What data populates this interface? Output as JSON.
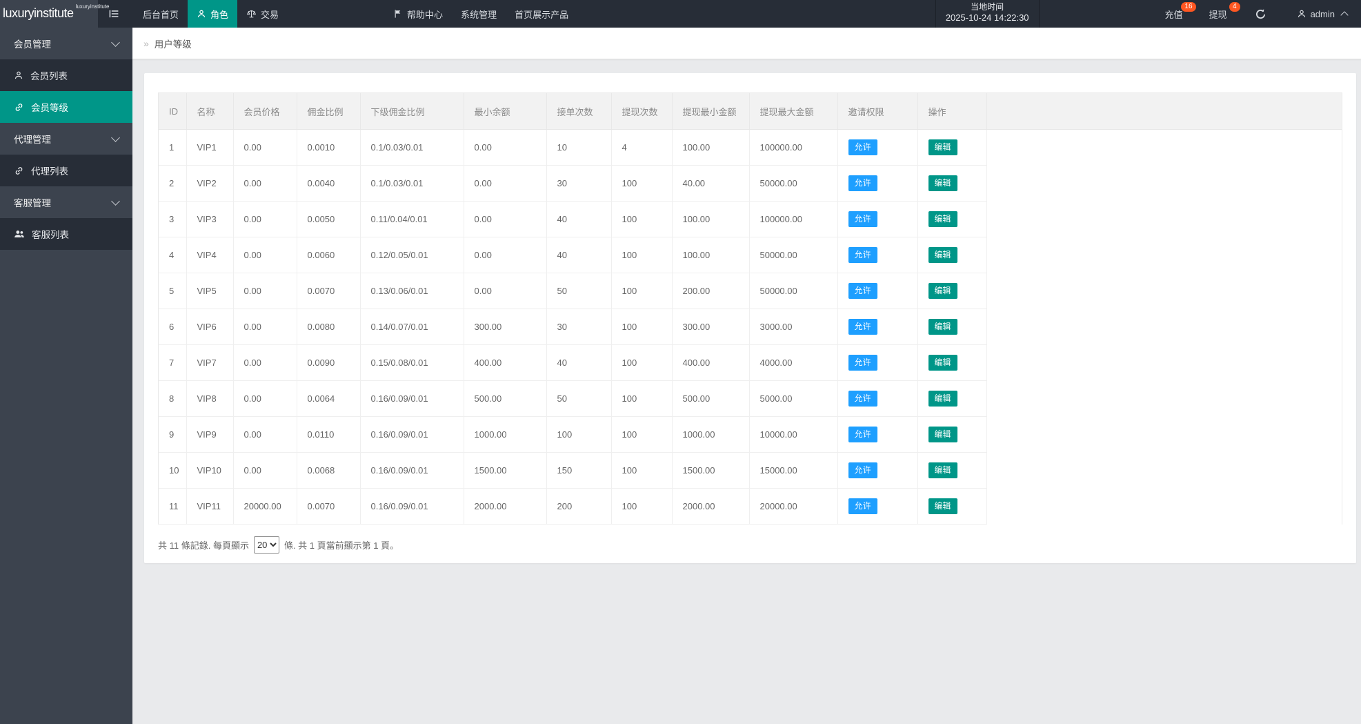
{
  "topbar": {
    "logo": "luxuryinstitute",
    "logo_superscript": "luxuryinstitute",
    "menu": [
      {
        "name": "home",
        "label": "后台首页",
        "icon": null,
        "active": false
      },
      {
        "name": "role",
        "label": "角色",
        "icon": "user",
        "active": true
      },
      {
        "name": "trade",
        "label": "交易",
        "icon": "scales",
        "active": false
      },
      {
        "name": "help-center",
        "label": "帮助中心",
        "icon": "flag",
        "active": false
      },
      {
        "name": "system",
        "label": "系统管理",
        "icon": null,
        "active": false
      },
      {
        "name": "home-products",
        "label": "首页展示产品",
        "icon": null,
        "active": false
      }
    ],
    "local_time_label": "当地时间",
    "local_time_value": "2025-10-24 14:22:30",
    "recharge": {
      "label": "充值",
      "badge": "16"
    },
    "withdraw": {
      "label": "提现",
      "badge": "4"
    },
    "user": "admin"
  },
  "sidebar": {
    "items": [
      {
        "name": "member-management",
        "label": "会员管理",
        "type": "group"
      },
      {
        "name": "member-list",
        "label": "会员列表",
        "type": "item",
        "icon": "user",
        "active": false
      },
      {
        "name": "member-level",
        "label": "会员等级",
        "type": "item",
        "icon": "link",
        "active": true
      },
      {
        "name": "agent-management",
        "label": "代理管理",
        "type": "group"
      },
      {
        "name": "agent-list",
        "label": "代理列表",
        "type": "item",
        "icon": "link",
        "active": false
      },
      {
        "name": "service-management",
        "label": "客服管理",
        "type": "group"
      },
      {
        "name": "service-list",
        "label": "客服列表",
        "type": "item",
        "icon": "users",
        "active": false
      }
    ]
  },
  "breadcrumb": {
    "separator": "»",
    "title": "用户等级"
  },
  "table": {
    "columns": [
      "ID",
      "名称",
      "会员价格",
      "佣金比例",
      "下级佣金比例",
      "最小余额",
      "接单次数",
      "提现次数",
      "提现最小金额",
      "提现最大金额",
      "邀请权限",
      "操作"
    ],
    "allow_label": "允许",
    "edit_label": "编辑",
    "rows": [
      [
        "1",
        "VIP1",
        "0.00",
        "0.0010",
        "0.1/0.03/0.01",
        "0.00",
        "10",
        "4",
        "100.00",
        "100000.00"
      ],
      [
        "2",
        "VIP2",
        "0.00",
        "0.0040",
        "0.1/0.03/0.01",
        "0.00",
        "30",
        "100",
        "40.00",
        "50000.00"
      ],
      [
        "3",
        "VIP3",
        "0.00",
        "0.0050",
        "0.11/0.04/0.01",
        "0.00",
        "40",
        "100",
        "100.00",
        "100000.00"
      ],
      [
        "4",
        "VIP4",
        "0.00",
        "0.0060",
        "0.12/0.05/0.01",
        "0.00",
        "40",
        "100",
        "100.00",
        "50000.00"
      ],
      [
        "5",
        "VIP5",
        "0.00",
        "0.0070",
        "0.13/0.06/0.01",
        "0.00",
        "50",
        "100",
        "200.00",
        "50000.00"
      ],
      [
        "6",
        "VIP6",
        "0.00",
        "0.0080",
        "0.14/0.07/0.01",
        "300.00",
        "30",
        "100",
        "300.00",
        "3000.00"
      ],
      [
        "7",
        "VIP7",
        "0.00",
        "0.0090",
        "0.15/0.08/0.01",
        "400.00",
        "40",
        "100",
        "400.00",
        "4000.00"
      ],
      [
        "8",
        "VIP8",
        "0.00",
        "0.0064",
        "0.16/0.09/0.01",
        "500.00",
        "50",
        "100",
        "500.00",
        "5000.00"
      ],
      [
        "9",
        "VIP9",
        "0.00",
        "0.0110",
        "0.16/0.09/0.01",
        "1000.00",
        "100",
        "100",
        "1000.00",
        "10000.00"
      ],
      [
        "10",
        "VIP10",
        "0.00",
        "0.0068",
        "0.16/0.09/0.01",
        "1500.00",
        "150",
        "100",
        "1500.00",
        "15000.00"
      ],
      [
        "11",
        "VIP11",
        "20000.00",
        "0.0070",
        "0.16/0.09/0.01",
        "2000.00",
        "200",
        "100",
        "2000.00",
        "20000.00"
      ]
    ]
  },
  "pagination": {
    "prefix": "共 11 條記錄. 每頁顯示",
    "page_size": "20",
    "suffix": "條. 共 1 頁當前顯示第 1 頁。"
  },
  "colors": {
    "accent_teal": "#009688",
    "accent_blue": "#1E9FFF",
    "badge_orange": "#FF5722",
    "topbar_bg": "#272d37",
    "sidebar_bg": "#3c434e"
  }
}
